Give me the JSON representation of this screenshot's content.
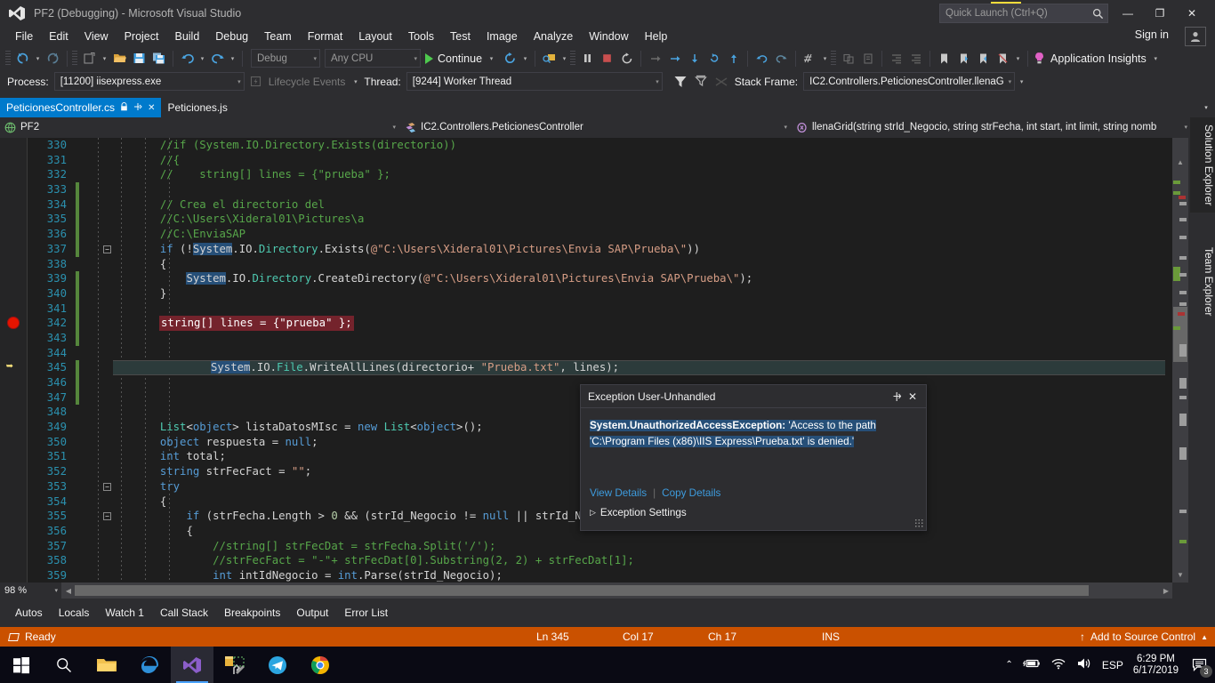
{
  "window": {
    "title": "PF2 (Debugging) - Microsoft Visual Studio",
    "minimize": "—",
    "restore": "❐",
    "close": "✕",
    "signin": "Sign in",
    "accent_blue": "#007acc",
    "status_orange": "#ca5100"
  },
  "quick_launch": {
    "placeholder": "Quick Launch (Ctrl+Q)",
    "icon": "search-icon"
  },
  "menu": {
    "items": [
      "File",
      "Edit",
      "View",
      "Project",
      "Build",
      "Debug",
      "Team",
      "Format",
      "Layout",
      "Tools",
      "Test",
      "Image",
      "Analyze",
      "Window",
      "Help"
    ]
  },
  "toolbar": {
    "configuration": "Debug",
    "platform": "Any CPU",
    "continue_label": "Continue",
    "app_insights": "Application Insights"
  },
  "debug_toolbar": {
    "process_label": "Process:",
    "process_value": "[11200] iisexpress.exe",
    "lifecycle_label": "Lifecycle Events",
    "thread_label": "Thread:",
    "thread_value": "[9244] Worker Thread",
    "stackframe_label": "Stack Frame:",
    "stackframe_value": "IC2.Controllers.PeticionesController.llenaG"
  },
  "tabs": [
    {
      "label": "PeticionesController.cs",
      "active": true,
      "pin": "⚔",
      "close": "✕"
    },
    {
      "label": "Peticiones.js",
      "active": false
    }
  ],
  "navbar": {
    "project": "PF2",
    "type": "IC2.Controllers.PeticionesController",
    "member": "llenaGrid(string strId_Negocio, string strFecha, int start, int limit, string nomb"
  },
  "editor": {
    "zoom": "98 %",
    "lines": [
      {
        "n": 330,
        "html": "<span class='cmt'>            //if (System.IO.Directory.Exists(directorio))</span>"
      },
      {
        "n": 331,
        "html": "<span class='cmt'>            //{</span>"
      },
      {
        "n": 332,
        "html": "<span class='cmt'>            //    string[] lines = {\"prueba\" };</span>"
      },
      {
        "n": 333,
        "html": "",
        "change": true
      },
      {
        "n": 334,
        "html": "<span class='cmt'>            // Crea el directorio del</span>",
        "change": true
      },
      {
        "n": 335,
        "html": "<span class='cmt'>            //C:\\Users\\Xideral01\\Pictures\\a</span>",
        "change": true
      },
      {
        "n": 336,
        "html": "<span class='cmt'>            //C:\\EnviaSAP</span>",
        "change": true
      },
      {
        "n": 337,
        "html": "            <span class='kw'>if</span> (!<span class='sel'>System</span>.IO.<span class='typ'>Directory</span>.Exists(<span class='str'>@\"C:\\Users\\Xideral01\\Pictures\\Envia SAP\\Prueba\\\"</span>))",
        "change": true,
        "fold": true
      },
      {
        "n": 338,
        "html": "            {"
      },
      {
        "n": 339,
        "html": "                <span class='sel'>System</span>.IO.<span class='typ'>Directory</span>.CreateDirectory(<span class='str'>@\"C:\\Users\\Xideral01\\Pictures\\Envia SAP\\Prueba\\\"</span>);",
        "change": true
      },
      {
        "n": 340,
        "html": "            }",
        "change": true
      },
      {
        "n": 341,
        "html": "",
        "change": true
      },
      {
        "n": 342,
        "html": "",
        "change": true,
        "breakpoint": true,
        "bp_text": "string[] lines = {\"prueba\" };"
      },
      {
        "n": 343,
        "html": "",
        "change": true
      },
      {
        "n": 344,
        "html": ""
      },
      {
        "n": 345,
        "html": "",
        "change": true,
        "current": true,
        "cur_text_html": "<span class='sel'>System</span>.IO.<span class='typ'>File</span>.WriteAllLines(directorio+ <span class='str'>\"Prueba.txt\"</span>, lines);"
      },
      {
        "n": 346,
        "html": "",
        "change": true
      },
      {
        "n": 347,
        "html": "",
        "change": true
      },
      {
        "n": 348,
        "html": ""
      },
      {
        "n": 349,
        "html": "            <span class='typ'>List</span>&lt;<span class='kw'>object</span>&gt; listaDatosMIsc = <span class='kw'>new</span> <span class='typ'>List</span>&lt;<span class='kw'>object</span>&gt;();"
      },
      {
        "n": 350,
        "html": "            <span class='kw'>object</span> respuesta = <span class='kw'>null</span>;"
      },
      {
        "n": 351,
        "html": "            <span class='kw'>int</span> total;"
      },
      {
        "n": 352,
        "html": "            <span class='kw'>string</span> strFecFact = <span class='str'>\"\"</span>;"
      },
      {
        "n": 353,
        "html": "            <span class='kw'>try</span>",
        "fold": true
      },
      {
        "n": 354,
        "html": "            {"
      },
      {
        "n": 355,
        "html": "                <span class='kw'>if</span> (strFecha.Length &gt; <span class='num'>0</span> &amp;&amp; (strId_Negocio != <span class='kw'>null</span> || strId_Nego",
        "fold": true
      },
      {
        "n": 356,
        "html": "                {"
      },
      {
        "n": 357,
        "html": "<span class='cmt'>                    //string[] strFecDat = strFecha.Split('/');</span>"
      },
      {
        "n": 358,
        "html": "<span class='cmt'>                    //strFecFact = \"-\"+ strFecDat[0].Substring(2, 2) + strFecDat[1];</span>"
      },
      {
        "n": 359,
        "html": "                    <span class='kw'>int</span> intIdNegocio = <span class='kw'>int</span>.Parse(strId_Negocio);"
      }
    ]
  },
  "exception": {
    "title": "Exception User-Unhandled",
    "pin_icon": "pin-icon",
    "close_icon": "close-icon",
    "type": "System.UnauthorizedAccessException:",
    "message": " 'Access to the path 'C:\\Program Files (x86)\\IIS Express\\Prueba.txt' is denied.'",
    "view_details": "View Details",
    "copy_details": "Copy Details",
    "settings": "Exception Settings"
  },
  "side_tabs": [
    "Solution Explorer",
    "Team Explorer"
  ],
  "bottom_tabs": [
    "Autos",
    "Locals",
    "Watch 1",
    "Call Stack",
    "Breakpoints",
    "Output",
    "Error List"
  ],
  "status_bar": {
    "ready": "Ready",
    "ln": "Ln 345",
    "col": "Col 17",
    "ch": "Ch 17",
    "ins": "INS",
    "source_control": "Add to Source Control",
    "up_arrow": "↑",
    "caret": "▲"
  },
  "taskbar": {
    "items": [
      "start-icon",
      "search-icon",
      "file-explorer-icon",
      "edge-icon",
      "visual-studio-icon",
      "tools-icon",
      "telegram-icon",
      "chrome-icon"
    ],
    "language": "ESP",
    "time": "6:29 PM",
    "date": "6/17/2019",
    "notification_count": "3"
  }
}
